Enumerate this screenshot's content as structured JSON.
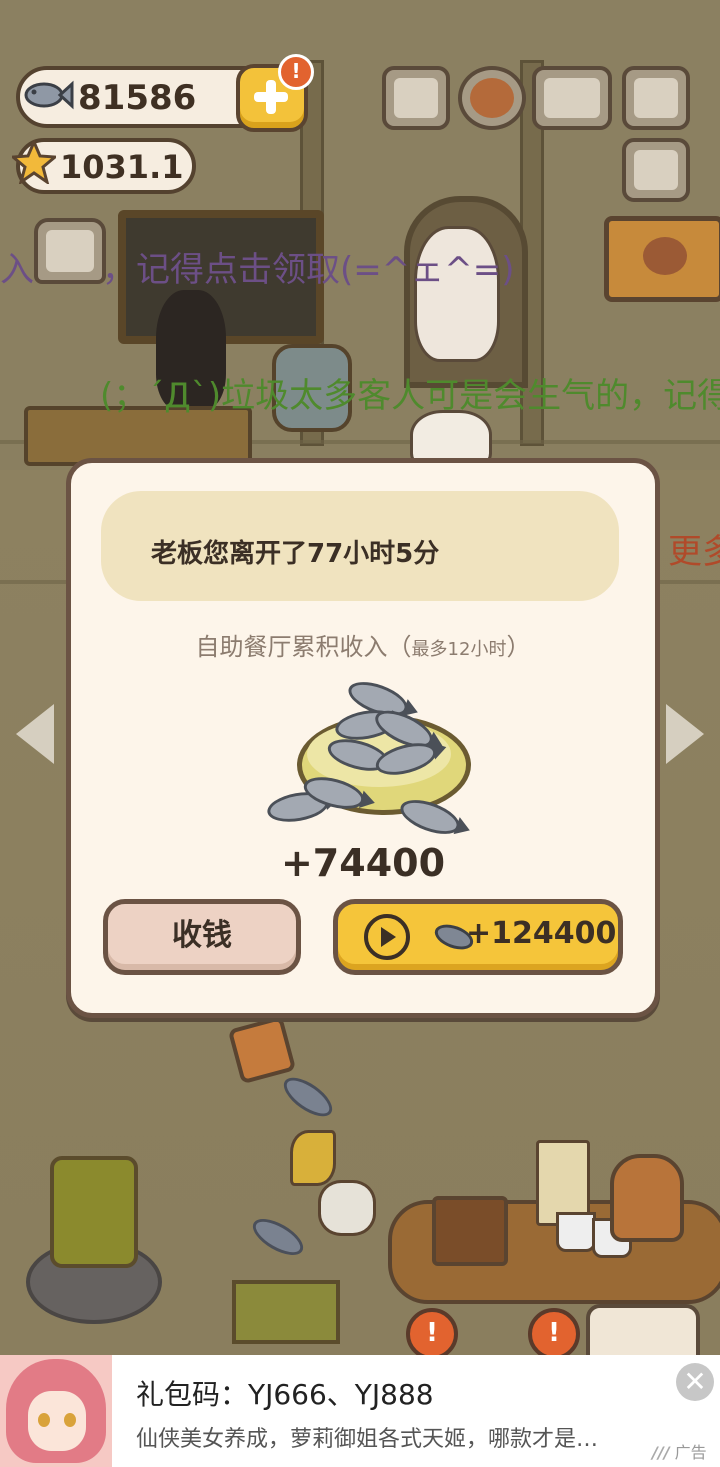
{
  "hud": {
    "fish_count": "81586",
    "star_rating": "1031.1",
    "badge": "!"
  },
  "marquee": {
    "line1": "入已满，记得点击领取(=^ェ^=)",
    "line2": "(；´Д`)垃圾太多客人可是会生气的，记得点",
    "line3": "更多的"
  },
  "dialog": {
    "message": "老板您离开了77小时5分",
    "subtitle_main": "自助餐厅累积收入（",
    "subtitle_small": "最多12小时",
    "subtitle_end": "）",
    "income": "+74400",
    "collect_label": "收钱",
    "video_amount": "+124400"
  },
  "ad": {
    "title": "礼包码：YJ666、YJ888",
    "description": "仙侠美女养成，萝莉御姐各式天姬，哪款才是…",
    "tag": "广告",
    "close": "✕"
  },
  "colors": {
    "accent": "#f5c53a",
    "dialog_bg": "#fdf5ea",
    "border": "#6b5344"
  }
}
